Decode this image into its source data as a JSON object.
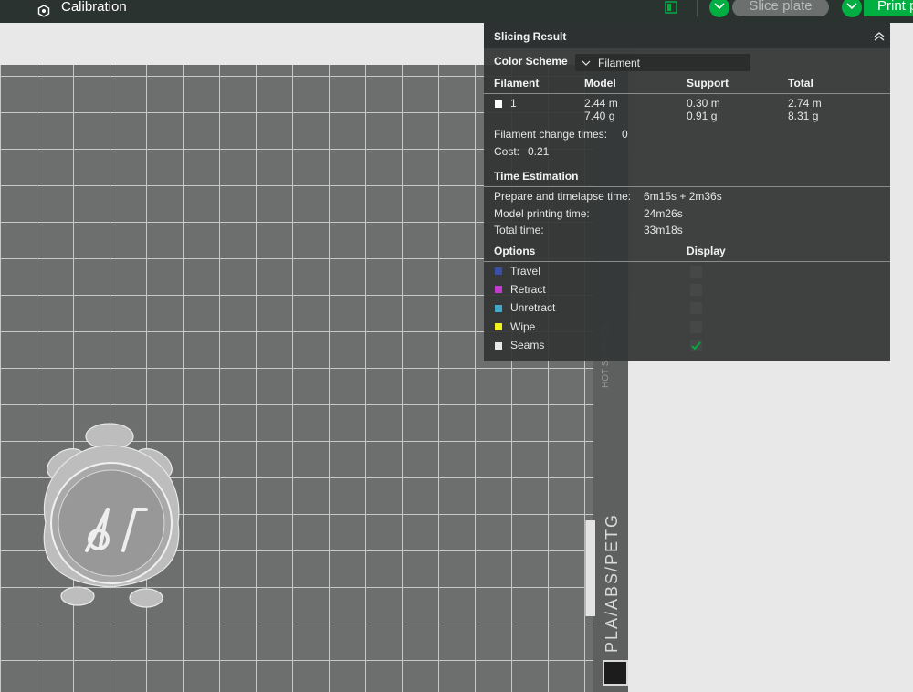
{
  "topbar": {
    "calibration_label": "Calibration",
    "slice_label": "Slice plate",
    "print_label": "Print p"
  },
  "plate": {
    "edge_label": "PLA/ABS/PETG",
    "hot_surface_label": "HOT SURFACE"
  },
  "panel": {
    "title": "Slicing Result",
    "color_scheme_label": "Color Scheme",
    "color_scheme_value": "Filament",
    "table": {
      "headers": [
        "Filament",
        "Model",
        "Support",
        "Total"
      ],
      "rows": [
        {
          "filament": "1",
          "model_len": "2.44 m",
          "model_wt": "7.40 g",
          "support_len": "0.30 m",
          "support_wt": "0.91 g",
          "total_len": "2.74 m",
          "total_wt": "8.31 g",
          "color": "#ffffff"
        }
      ]
    },
    "filament_change_label": "Filament change times:",
    "filament_change_value": "0",
    "cost_label": "Cost:",
    "cost_value": "0.21",
    "time_estimation_title": "Time Estimation",
    "prepare_label": "Prepare and timelapse time:",
    "prepare_value": "6m15s + 2m36s",
    "model_time_label": "Model printing time:",
    "model_time_value": "24m26s",
    "total_time_label": "Total time:",
    "total_time_value": "33m18s",
    "options_header": "Options",
    "display_header": "Display",
    "options": [
      {
        "label": "Travel",
        "color": "#3a4fa8",
        "checked": false
      },
      {
        "label": "Retract",
        "color": "#c23ad2",
        "checked": false
      },
      {
        "label": "Unretract",
        "color": "#40a8c8",
        "checked": false
      },
      {
        "label": "Wipe",
        "color": "#f2f21e",
        "checked": false
      },
      {
        "label": "Seams",
        "color": "#e8e8e8",
        "checked": true
      }
    ]
  },
  "colors": {
    "accent": "#00ae42",
    "topbar": "#2b3330",
    "plate": "#6d6f6f",
    "panel": "#343636"
  }
}
